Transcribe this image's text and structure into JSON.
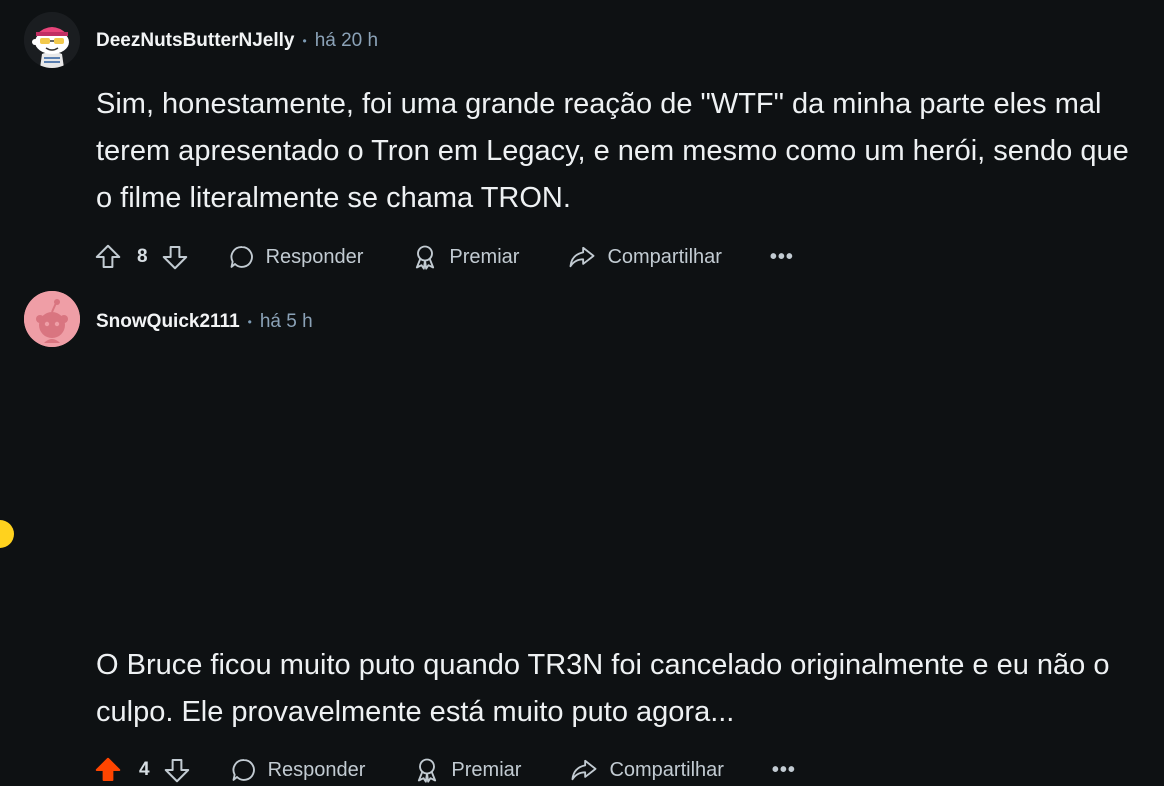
{
  "comments": [
    {
      "author": "DeezNutsButterNJelly",
      "separator": "•",
      "time": "há 20 h",
      "body": "Sim, honestamente, foi uma grande reação de \"WTF\" da minha parte eles mal terem apresentado o Tron em Legacy, e nem mesmo como um herói, sendo que o filme literalmente se chama TRON.",
      "votes": "8",
      "upvoted": false,
      "reply_label": "Responder",
      "award_label": "Premiar",
      "share_label": "Compartilhar",
      "more_label": "•••"
    },
    {
      "author": "SnowQuick2111",
      "separator": "•",
      "time": "há 5 h",
      "body": "O Bruce ficou muito puto quando TR3N foi cancelado originalmente e eu não o culpo. Ele provavelmente está muito puto agora...",
      "votes": "4",
      "upvoted": true,
      "reply_label": "Responder",
      "award_label": "Premiar",
      "share_label": "Compartilhar",
      "more_label": "•••"
    }
  ],
  "colors": {
    "background": "#0e1113",
    "upvote_active": "#ff4500",
    "meta_time": "#8ba2b7",
    "action_text": "#c2cbd2"
  },
  "icons": [
    "upvote-icon",
    "downvote-icon",
    "comment-bubble-icon",
    "award-icon",
    "share-icon",
    "more-icon"
  ]
}
